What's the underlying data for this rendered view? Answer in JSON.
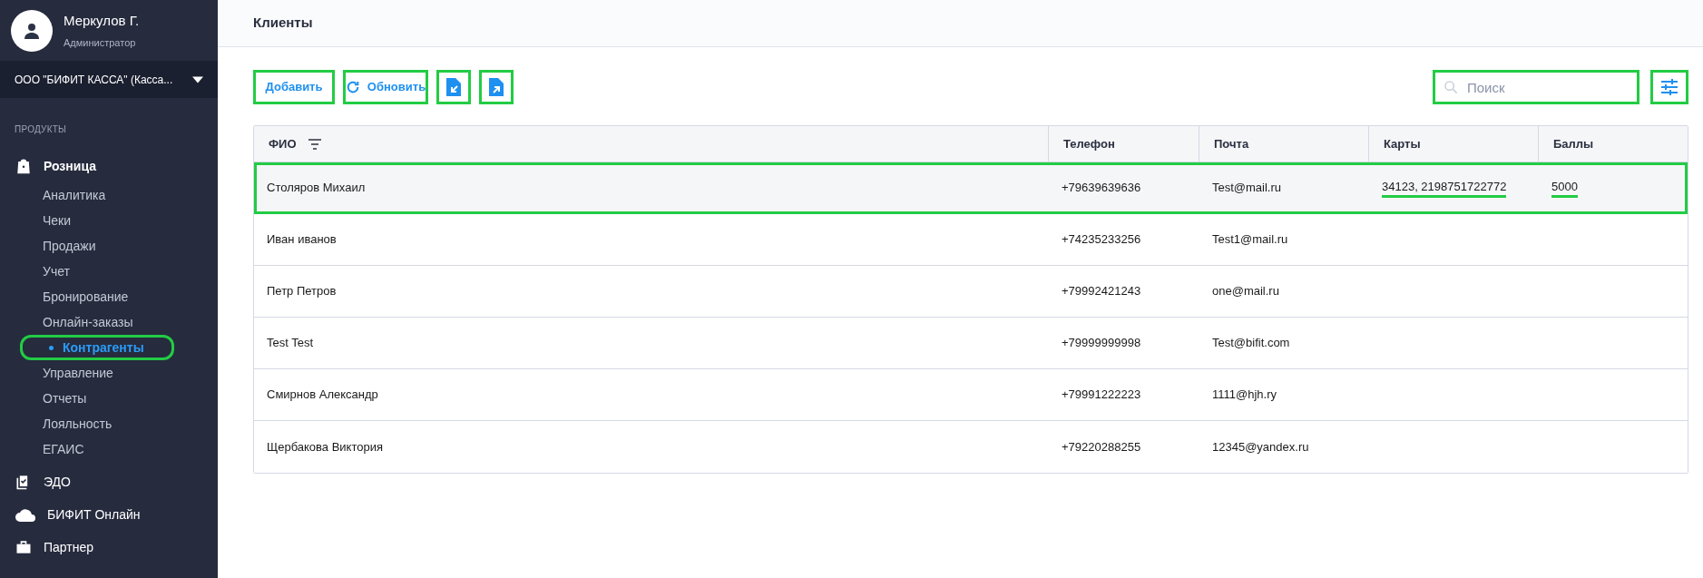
{
  "user": {
    "name": "Меркулов Г.",
    "role": "Администратор"
  },
  "company": {
    "label": "ООО \"БИФИТ КАССА\" (Касса..."
  },
  "sidebar": {
    "section": "ПРОДУКТЫ",
    "items": [
      {
        "label": "Розница",
        "expanded": true,
        "children": [
          {
            "label": "Аналитика",
            "selected": false,
            "highlighted": false
          },
          {
            "label": "Чеки",
            "selected": false,
            "highlighted": false
          },
          {
            "label": "Продажи",
            "selected": false,
            "highlighted": false
          },
          {
            "label": "Учет",
            "selected": false,
            "highlighted": false
          },
          {
            "label": "Бронирование",
            "selected": false,
            "highlighted": false
          },
          {
            "label": "Онлайн-заказы",
            "selected": false,
            "highlighted": false
          },
          {
            "label": "Контрагенты",
            "selected": true,
            "highlighted": true
          },
          {
            "label": "Управление",
            "selected": false,
            "highlighted": false
          },
          {
            "label": "Отчеты",
            "selected": false,
            "highlighted": false
          },
          {
            "label": "Лояльность",
            "selected": false,
            "highlighted": false
          },
          {
            "label": "ЕГАИС",
            "selected": false,
            "highlighted": false
          }
        ]
      },
      {
        "label": "ЭДО",
        "expanded": false
      },
      {
        "label": "БИФИТ Онлайн",
        "expanded": false
      },
      {
        "label": "Партнер",
        "expanded": false
      }
    ]
  },
  "page_title": "Клиенты",
  "toolbar": {
    "buttons": [
      {
        "kind": "text",
        "label": "Добавить",
        "highlighted": true
      },
      {
        "kind": "refresh",
        "label": "Обновить",
        "highlighted": true
      },
      {
        "kind": "import",
        "highlighted": true
      },
      {
        "kind": "export",
        "highlighted": true
      }
    ],
    "search": {
      "placeholder": "Поиск",
      "highlighted": true
    },
    "settings": {
      "highlighted": true
    }
  },
  "table": {
    "columns": [
      "ФИО",
      "Телефон",
      "Почта",
      "Карты",
      "Баллы"
    ],
    "rows": [
      {
        "cells": [
          "Столяров Михаил",
          "+79639639636",
          "Test@mail.ru",
          "34123, 2198751722772",
          "5000"
        ],
        "highlighted": true
      },
      {
        "cells": [
          "Иван иванов",
          "+74235233256",
          "Test1@mail.ru",
          "",
          ""
        ],
        "highlighted": false
      },
      {
        "cells": [
          "Петр Петров",
          "+79992421243",
          "one@mail.ru",
          "",
          ""
        ],
        "highlighted": false
      },
      {
        "cells": [
          "Test Test",
          "+79999999998",
          "Test@bifit.com",
          "",
          ""
        ],
        "highlighted": false
      },
      {
        "cells": [
          "Смирнов Александр",
          "+79991222223",
          "1111@hjh.ry",
          "",
          ""
        ],
        "highlighted": false
      },
      {
        "cells": [
          "Щербакова Виктория",
          "+79220288255",
          "12345@yandex.ru",
          "",
          ""
        ],
        "highlighted": false
      }
    ]
  }
}
